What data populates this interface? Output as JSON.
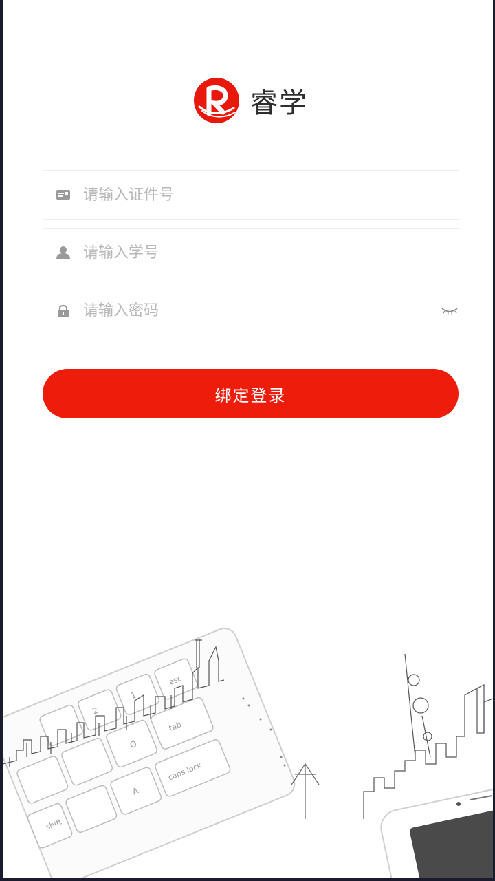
{
  "app": {
    "logo_text": "睿学",
    "brand_color": "#e8180c"
  },
  "form": {
    "id_field": {
      "placeholder": "请输入证件号",
      "value": "",
      "icon": "id-card-icon"
    },
    "student_field": {
      "placeholder": "请输入学号",
      "value": "",
      "icon": "user-icon"
    },
    "password_field": {
      "placeholder": "请输入密码",
      "value": "",
      "icon": "lock-icon",
      "toggle_icon": "eye-closed-icon"
    }
  },
  "login_button": {
    "label": "绑定登录",
    "color": "#ee1c0a"
  },
  "illustration": {
    "keyboard_keys": [
      "esc",
      "tab",
      "caps lock",
      "Q",
      "shift",
      "A",
      "1",
      "2"
    ]
  }
}
